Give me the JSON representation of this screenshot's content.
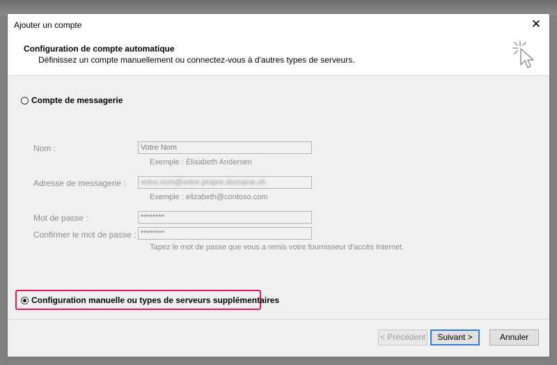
{
  "window": {
    "title": "Ajouter un compte"
  },
  "header": {
    "title": "Configuration de compte automatique",
    "subtitle": "Définissez un compte manuellement ou connectez-vous à d'autres types de serveurs."
  },
  "options": {
    "email_account": {
      "label": "Compte de messagerie",
      "selected": false
    },
    "manual_config": {
      "label": "Configuration manuelle ou types de serveurs supplémentaires",
      "selected": true
    }
  },
  "form": {
    "name": {
      "label": "Nom :",
      "value": "Votre Nom",
      "hint": "Exemple : Élisabeth Andersen"
    },
    "email": {
      "label": "Adresse de messagerie :",
      "value": "votre.nom@votre.propre.domaine.ch",
      "hint": "Exemple : elizabeth@contoso.com"
    },
    "password": {
      "label": "Mot de passe :",
      "value": "********"
    },
    "confirm_password": {
      "label": "Confirmer le mot de passe :",
      "value": "********"
    },
    "password_hint": "Tapez le mot de passe que vous a remis votre fournisseur d'accès Internet."
  },
  "buttons": {
    "back": "< Précédent",
    "next": "Suivant >",
    "cancel": "Annuler"
  },
  "colors": {
    "highlight": "#e0185a",
    "default_button_border": "#2f7dd4"
  }
}
